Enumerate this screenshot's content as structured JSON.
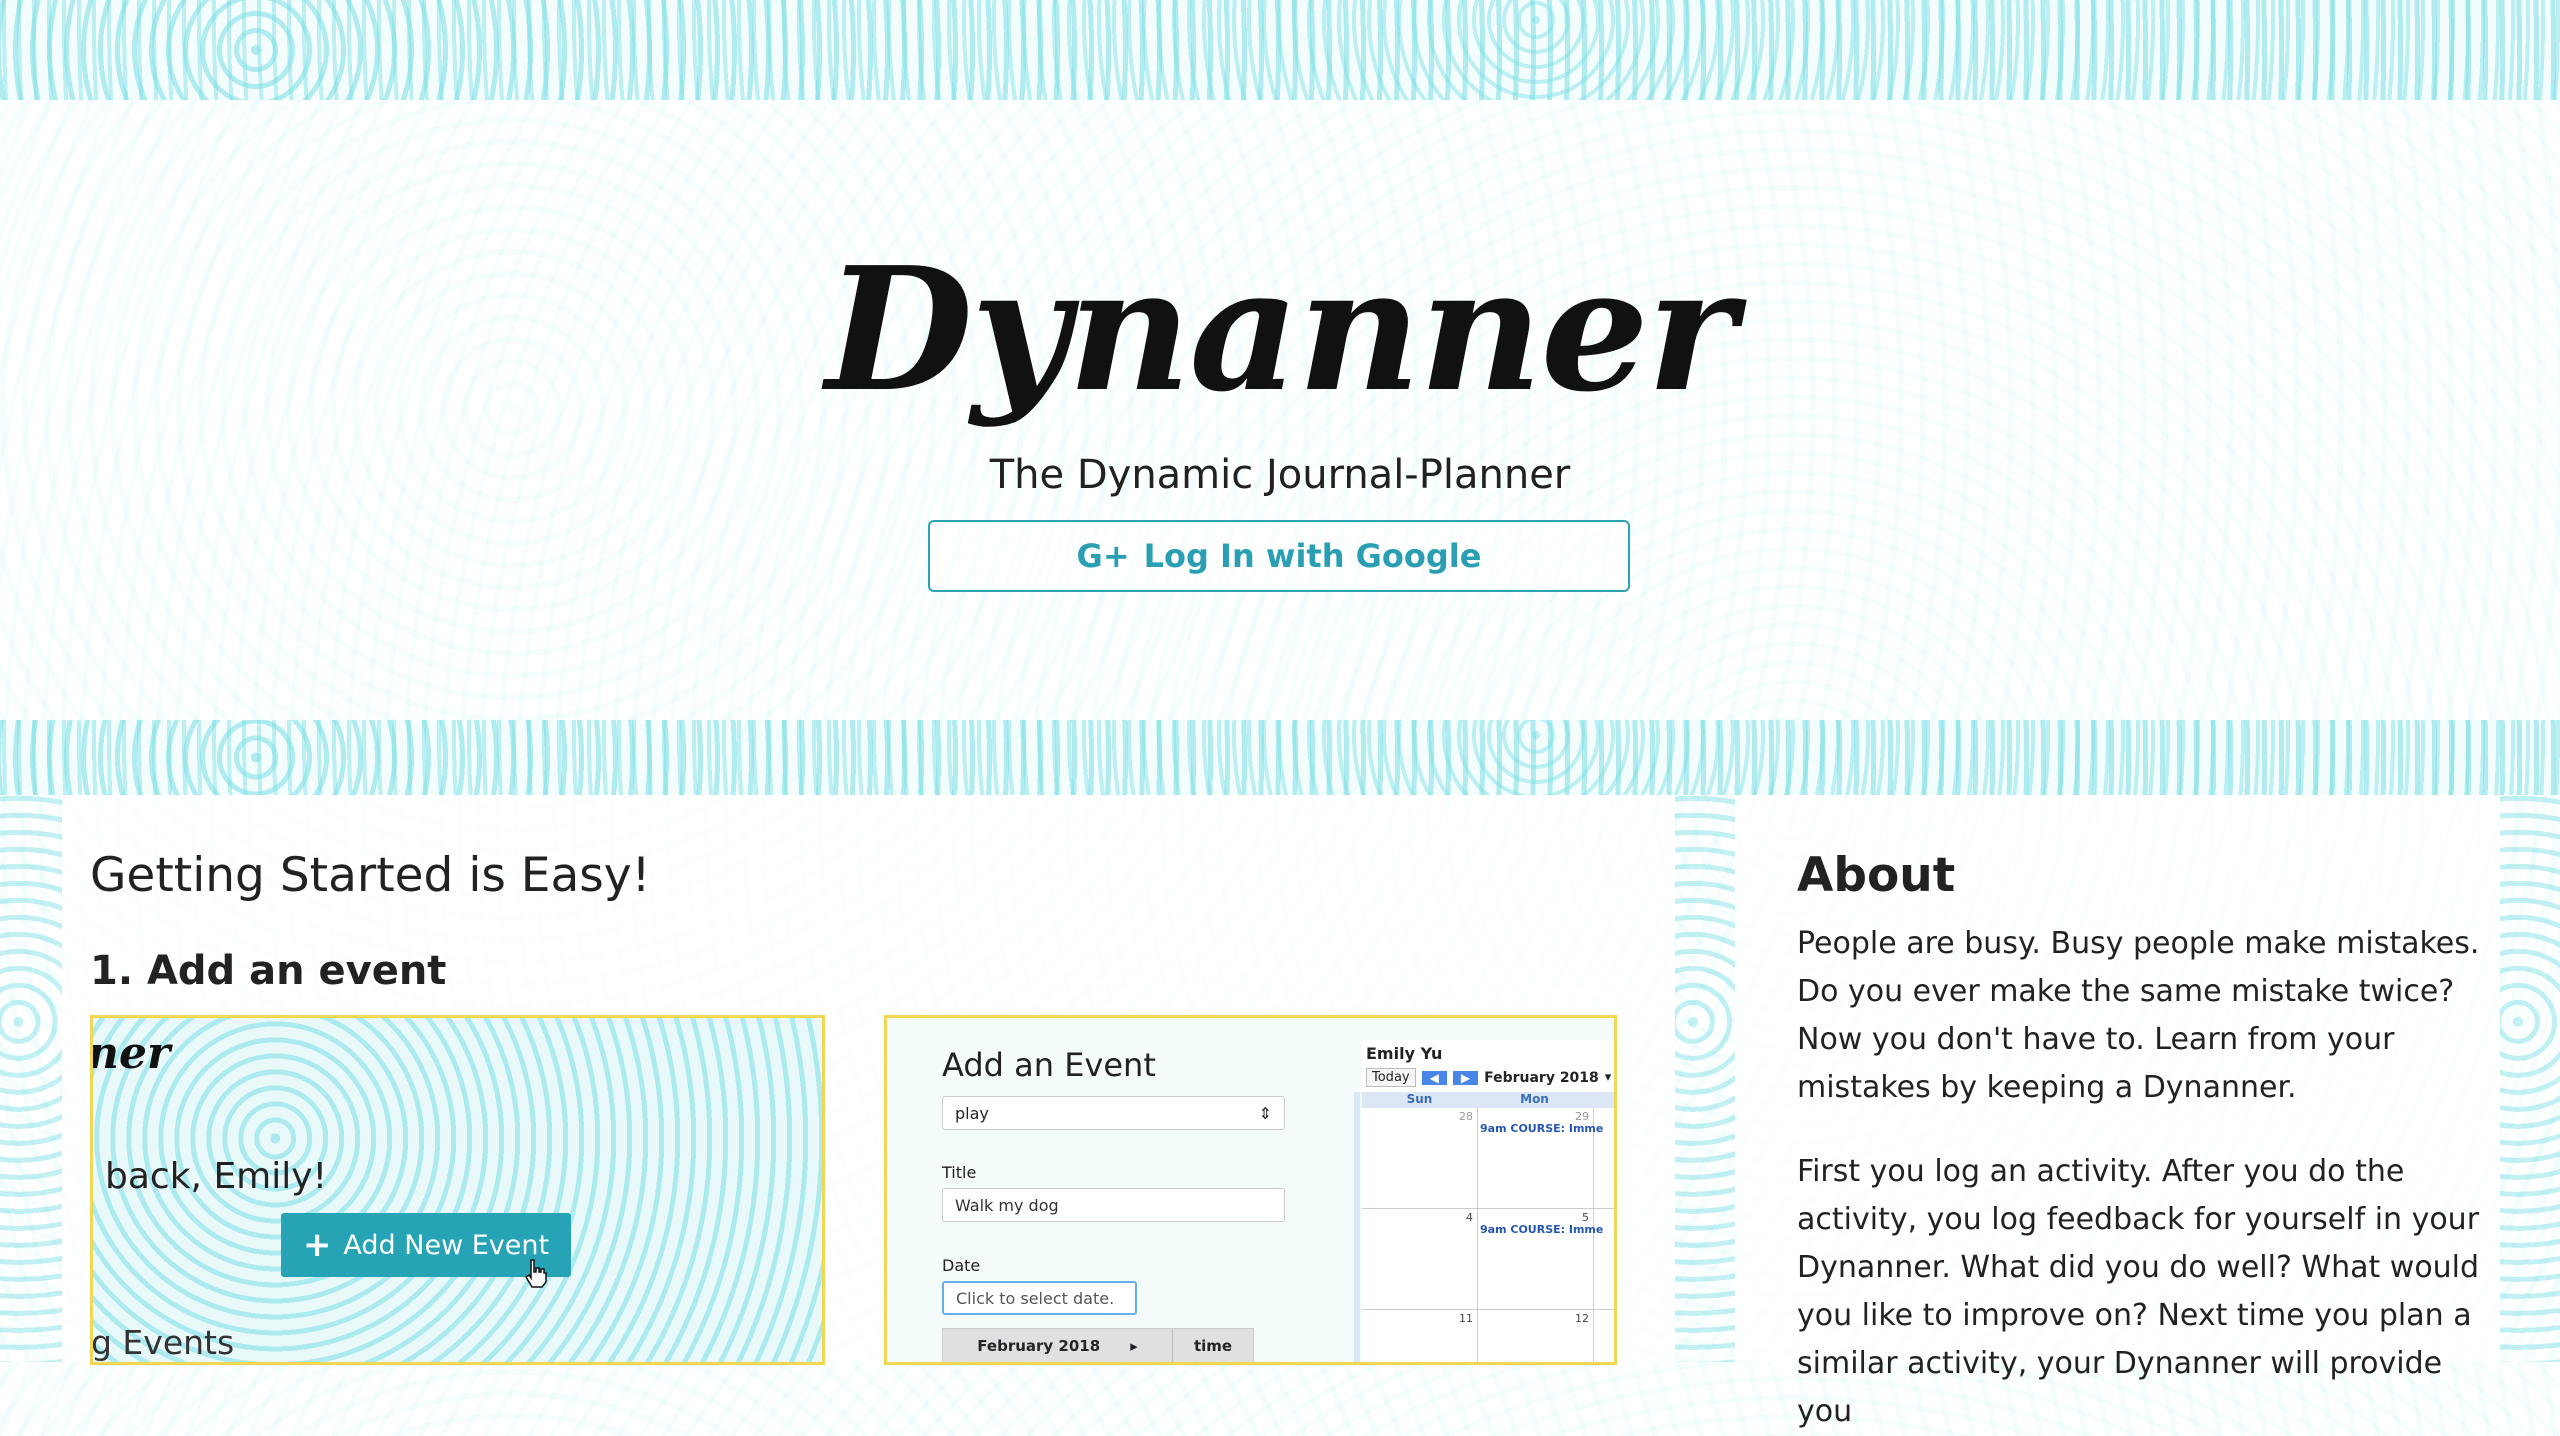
{
  "hero": {
    "brand": "Dynanner",
    "tagline": "The Dynamic Journal-Planner",
    "login_icon": "G+",
    "login_label": "Log In with Google"
  },
  "getting_started": {
    "heading": "Getting Started is Easy!",
    "step1": "1. Add an event"
  },
  "screenshot1": {
    "logo_fragment": "ner",
    "welcome_fragment": "back, Emily!",
    "add_button_icon": "+",
    "add_button_label": "Add New Event",
    "cursor_icon": "pointer-hand-icon",
    "events_fragment": "g Events"
  },
  "screenshot2": {
    "title": "Add an Event",
    "category_value": "play",
    "title_label": "Title",
    "title_value": "Walk my dog",
    "date_label": "Date",
    "date_placeholder": "Click to select date.",
    "picker_month": "February 2018",
    "picker_time": "time",
    "calendar": {
      "user": "Emily Yu",
      "today": "Today",
      "month": "February 2018",
      "days": [
        "Sun",
        "Mon"
      ],
      "rows": [
        {
          "sun": "28",
          "mon": "29",
          "event": "9am COURSE: Imme"
        },
        {
          "sun": "4",
          "mon": "5",
          "event": "9am COURSE: Imme"
        },
        {
          "sun": "11",
          "mon": "12",
          "event": ""
        }
      ]
    }
  },
  "about": {
    "heading": "About",
    "p1": "People are busy. Busy people make mistakes. Do you ever make the same mistake twice? Now you don't have to. Learn from your mistakes by keeping a Dynanner.",
    "p2": "First you log an activity. After you do the activity, you log feedback for yourself in your Dynanner. What did you do well? What would you like to improve on? Next time you plan a similar activity, your Dynanner will provide you"
  },
  "colors": {
    "accent": "#2aa3b4",
    "pattern": "#78dee4",
    "highlight_border": "#f2d755"
  }
}
